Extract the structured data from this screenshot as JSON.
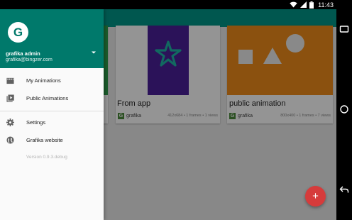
{
  "status_bar": {
    "time": "11:43"
  },
  "drawer": {
    "user_name": "grafika admin",
    "user_email": "grafika@bingzer.com",
    "logo_letter": "G",
    "items": [
      {
        "label": "My Animations",
        "icon": "movie-icon"
      },
      {
        "label": "Public Animations",
        "icon": "video-library-icon"
      },
      {
        "label": "Settings",
        "icon": "gear-icon"
      },
      {
        "label": "Grafika website",
        "icon": "globe-icon"
      }
    ],
    "version": "Version 0.9.3.debug"
  },
  "cards": [
    {
      "title": "",
      "owner": "",
      "stats": "",
      "color": "#2e9e4b"
    },
    {
      "title": "From app",
      "owner": "grafika",
      "stats": "412x684 • 1 frames • 1 views",
      "color": "#4a1f9a",
      "icon": "star-icon",
      "icon_color": "#1fb5a6"
    },
    {
      "title": "public animation",
      "owner": "grafika",
      "stats": "800x400 • 1 frames • 7 views",
      "color": "#f08c1a"
    }
  ],
  "fab": {
    "label": "+"
  },
  "colors": {
    "primary": "#009688",
    "primary_dark": "#00796b",
    "accent": "#d63b3b"
  }
}
